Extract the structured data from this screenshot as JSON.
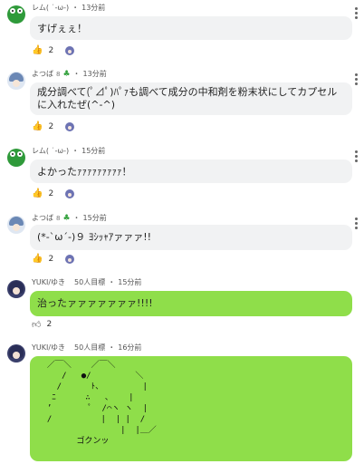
{
  "messages": [
    {
      "user": "レム( ˙-ω-)",
      "time": "13分前",
      "text": "すげぇぇ！",
      "likes": "2",
      "avatar": "frog-avatar-icon"
    },
    {
      "user": "よつば",
      "badge": "8",
      "time": "13分前",
      "text": "成分調べて(ﾟ⊿ﾟ)ﾊﾟｧも調べて成分の中和剤を粉末状にしてカプセルに入れたぜ(^-^)",
      "likes": "2",
      "avatar": "girl-avatar-icon"
    },
    {
      "user": "レム( ˙-ω-)",
      "time": "15分前",
      "text": "よかったｧｧｧｧｧｧｧｧｧ！",
      "likes": "2",
      "avatar": "frog-avatar-icon"
    },
    {
      "user": "よつば",
      "badge": "8",
      "time": "15分前",
      "text": "(*-`ω´-)９ ﾖｼｯｬｱァァァ!!",
      "likes": "2",
      "avatar": "girl-avatar-icon"
    },
    {
      "user": "YUKI/ゆき",
      "goal": "50人目標",
      "time": "15分前",
      "text": "治ったァァァァァァァ!!!!",
      "likes": "2",
      "avatar": "navy-avatar-icon"
    },
    {
      "user": "YUKI/ゆき",
      "goal": "50人目標",
      "time": "16分前",
      "ascii_art": "  ／￣＼    ／￣＼\n     /   ●/         ＼\n    /      ﾄ、        |\n   ﾆ      ∴   ､    |\n  ’        ﾟ  /⌒ヽ ヽ  |\n  /          |  | |  /\n                 |  |＿／\n        ゴクンッ",
      "avatar": "navy-avatar-icon"
    }
  ],
  "ui": {
    "meta_separator": "・",
    "avatar_icon": "avatar-icon",
    "thumbs_up_icon": "thumbs-up-icon",
    "more_icon": "more-vertical-icon"
  },
  "colors": {
    "bubble_gray": "#f1f2f3",
    "bubble_green": "#8fde4a",
    "like_blue": "#2d77e8"
  }
}
